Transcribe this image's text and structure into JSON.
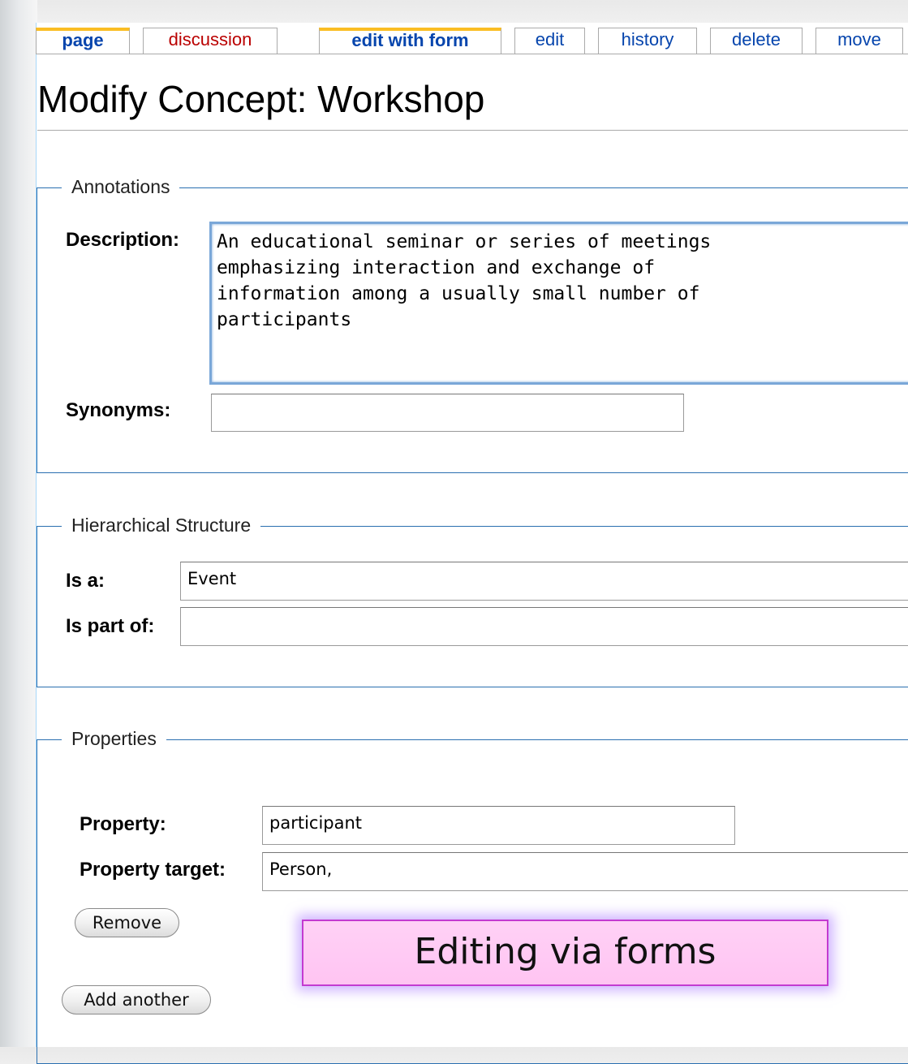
{
  "tabs": [
    {
      "label": "page",
      "selected": true,
      "new": false
    },
    {
      "label": "discussion",
      "selected": false,
      "new": true
    },
    {
      "label": "edit with form",
      "selected": true,
      "new": false
    },
    {
      "label": "edit",
      "selected": false,
      "new": false
    },
    {
      "label": "history",
      "selected": false,
      "new": false
    },
    {
      "label": "delete",
      "selected": false,
      "new": false
    },
    {
      "label": "move",
      "selected": false,
      "new": false
    }
  ],
  "page": {
    "title": "Modify Concept: Workshop"
  },
  "annotations": {
    "legend": "Annotations",
    "description_label": "Description:",
    "description_value": "An educational seminar or series of meetings\nemphasizing interaction and exchange of\ninformation among a usually small number of\nparticipants",
    "synonyms_label": "Synonyms:",
    "synonyms_value": ""
  },
  "hierarchy": {
    "legend": "Hierarchical Structure",
    "is_a_label": "Is a:",
    "is_a_value": "Event",
    "is_part_of_label": "Is part of:",
    "is_part_of_value": ""
  },
  "properties": {
    "legend": "Properties",
    "property_label": "Property:",
    "property_value": "participant",
    "target_label": "Property target:",
    "target_value": "Person,",
    "remove_label": "Remove",
    "add_label": "Add another"
  },
  "callout": {
    "text": "Editing via forms",
    "border_color": "#c33bd0",
    "fill_color": "#ffc4f2"
  },
  "colors": {
    "link": "#0645ad",
    "new_link": "#ba0000",
    "selected_tab_accent": "#fabd23",
    "fieldset_border": "#2a6fb0"
  }
}
